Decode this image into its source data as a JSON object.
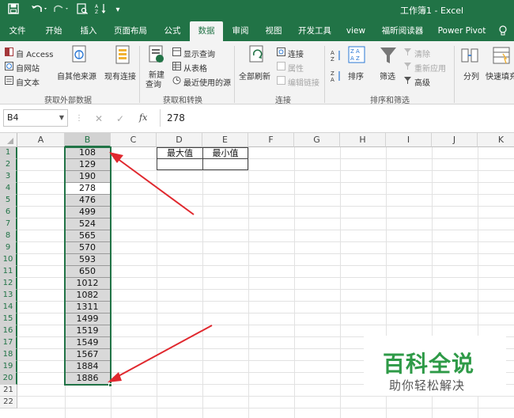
{
  "window": {
    "title": "工作簿1 - Excel"
  },
  "quick_access": {
    "save_icon": "save-icon",
    "undo_icon": "undo-icon",
    "redo_icon": "redo-icon",
    "preview_icon": "print-preview-icon",
    "sort_icon": "sort-icon",
    "customize_icon": "customize-icon"
  },
  "tabs": [
    {
      "label": "文件"
    },
    {
      "label": "开始"
    },
    {
      "label": "插入"
    },
    {
      "label": "页面布局"
    },
    {
      "label": "公式"
    },
    {
      "label": "数据"
    },
    {
      "label": "审阅"
    },
    {
      "label": "视图"
    },
    {
      "label": "开发工具"
    },
    {
      "label": "view"
    },
    {
      "label": "福昕阅读器"
    },
    {
      "label": "Power Pivot"
    }
  ],
  "ribbon": {
    "ext_access": "自 Access",
    "ext_web": "自网站",
    "ext_text": "自文本",
    "ext_other": "自其他来源",
    "existing": "现有连接",
    "group_external": "获取外部数据",
    "new_query_1": "新建",
    "new_query_2": "查询",
    "show_query": "显示查询",
    "from_table": "从表格",
    "recent_src": "最近使用的源",
    "group_transform": "获取和转换",
    "refresh_all": "全部刷新",
    "conn": "连接",
    "props": "属性",
    "edit_links": "编辑链接",
    "group_conn": "连接",
    "sort": "排序",
    "filter": "筛选",
    "clear": "清除",
    "reapply": "重新应用",
    "advanced": "高级",
    "group_sort": "排序和筛选",
    "split": "分列",
    "flash_fill": "快速填充"
  },
  "formula_bar": {
    "name_box": "B4",
    "value": "278",
    "cancel": "✕",
    "enter": "✓",
    "fx": "fx"
  },
  "columns": [
    "A",
    "B",
    "C",
    "D",
    "E",
    "F",
    "G",
    "H",
    "I",
    "J",
    "K"
  ],
  "rows": [
    "1",
    "2",
    "3",
    "4",
    "5",
    "6",
    "7",
    "8",
    "9",
    "10",
    "11",
    "12",
    "13",
    "14",
    "15",
    "16",
    "17",
    "18",
    "19",
    "20",
    "21",
    "22"
  ],
  "column_b_values": [
    "108",
    "129",
    "190",
    "278",
    "476",
    "499",
    "524",
    "565",
    "570",
    "593",
    "650",
    "1012",
    "1082",
    "1311",
    "1499",
    "1519",
    "1549",
    "1567",
    "1884",
    "1886"
  ],
  "active_cell": "B4",
  "summary_table": {
    "max_label": "最大值",
    "min_label": "最小值"
  },
  "watermark": {
    "title": "百科全说",
    "subtitle": "助你轻松解决"
  },
  "colors": {
    "excel_green": "#217346",
    "arrow_red": "#e0282e",
    "selected_fill": "#d9d9d9"
  }
}
